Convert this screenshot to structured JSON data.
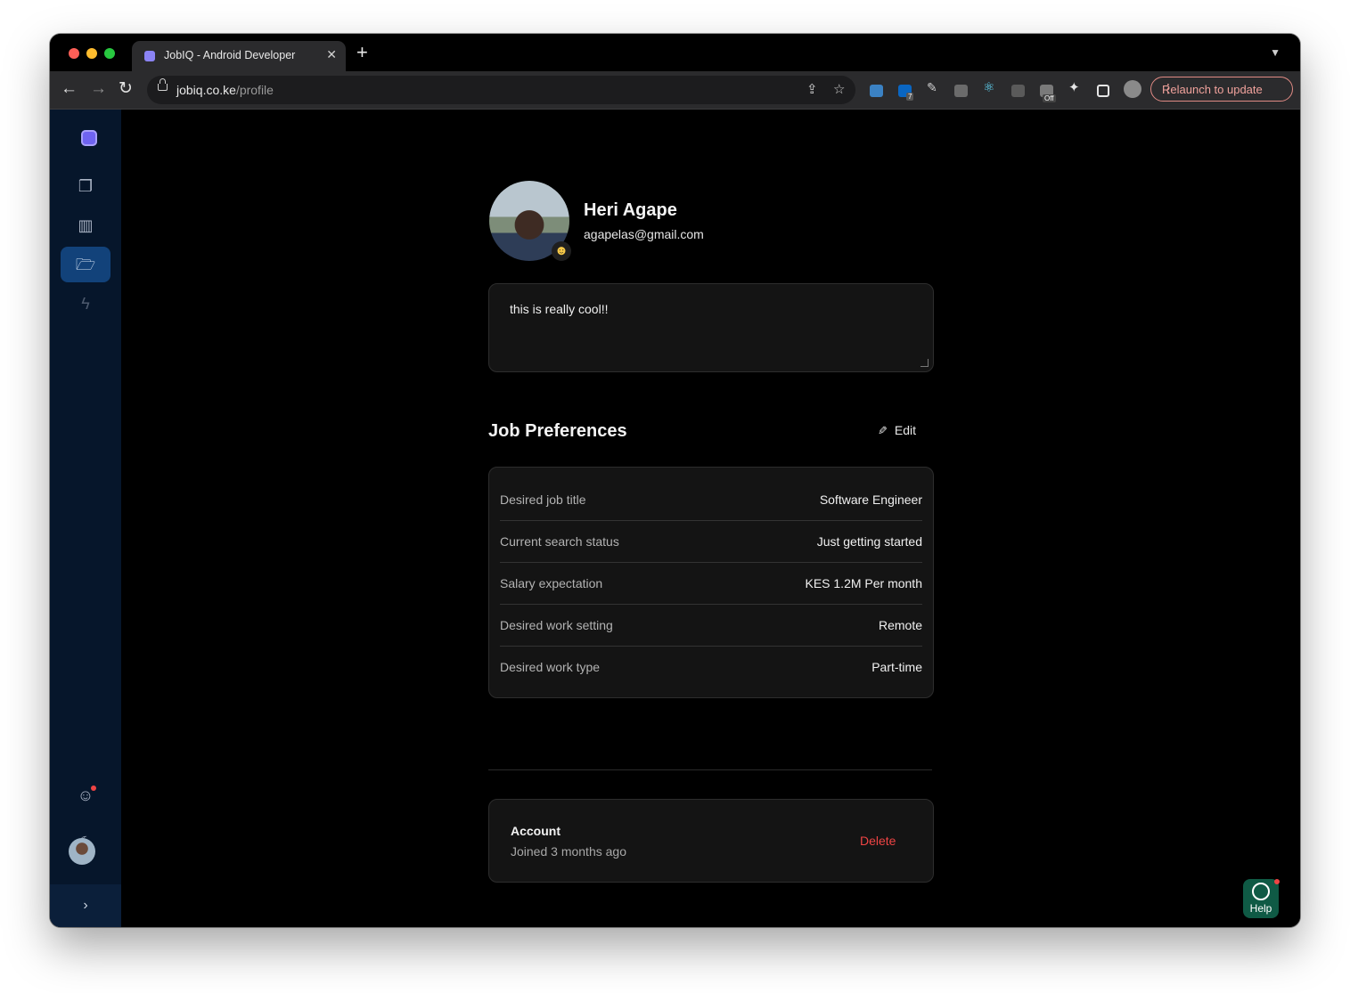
{
  "browser": {
    "tab_title": "JobIQ - Android Developer",
    "url_host": "jobiq.co.ke",
    "url_path": "/profile",
    "relaunch_label": "Relaunch to update",
    "extension_badges": {
      "linkedin": "7",
      "off": "Off"
    }
  },
  "sidebar": {
    "items": [
      {
        "icon": "copy-icon"
      },
      {
        "icon": "kanban-icon"
      },
      {
        "icon": "folder-open-icon",
        "active": true
      },
      {
        "icon": "bolt-icon"
      }
    ]
  },
  "profile": {
    "name": "Heri Agape",
    "email": "agapelas@gmail.com",
    "bio": "this is really cool!!"
  },
  "preferences": {
    "title": "Job Preferences",
    "edit_label": "Edit",
    "rows": [
      {
        "label": "Desired job title",
        "value": "Software Engineer"
      },
      {
        "label": "Current search status",
        "value": "Just getting started"
      },
      {
        "label": "Salary expectation",
        "value": "KES 1.2M Per month"
      },
      {
        "label": "Desired work setting",
        "value": "Remote"
      },
      {
        "label": "Desired work type",
        "value": "Part-time"
      }
    ]
  },
  "account": {
    "title": "Account",
    "joined": "Joined 3 months ago",
    "delete_label": "Delete"
  },
  "help": {
    "label": "Help"
  },
  "colors": {
    "sidebar_bg": "#06162b",
    "sidebar_active": "#12427a",
    "danger": "#ef4444",
    "help_bg": "#0f5a45"
  }
}
